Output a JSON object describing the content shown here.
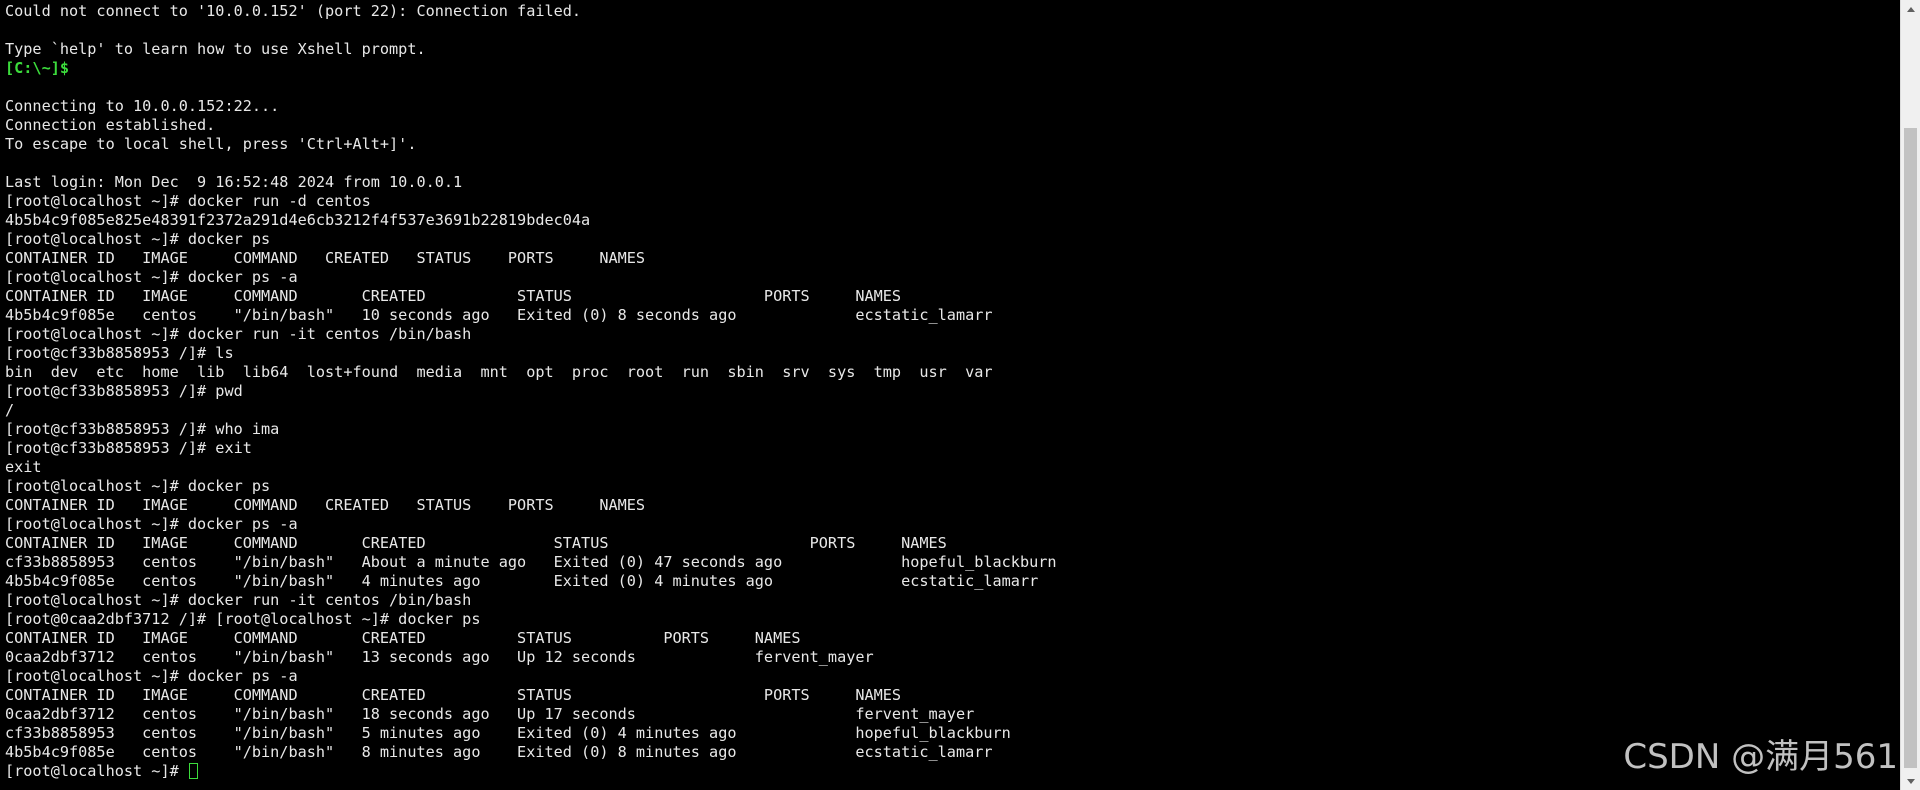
{
  "terminal": {
    "lines": [
      {
        "text": "Could not connect to '10.0.0.152' (port 22): Connection failed."
      },
      {
        "text": ""
      },
      {
        "text": "Type `help' to learn how to use Xshell prompt."
      },
      {
        "text": "[C:\\~]$"
      },
      {
        "text": ""
      },
      {
        "text": "Connecting to 10.0.0.152:22..."
      },
      {
        "text": "Connection established."
      },
      {
        "text": "To escape to local shell, press 'Ctrl+Alt+]'."
      },
      {
        "text": ""
      },
      {
        "text": "Last login: Mon Dec  9 16:52:48 2024 from 10.0.0.1"
      },
      {
        "text": "[root@localhost ~]# docker run -d centos"
      },
      {
        "text": "4b5b4c9f085e825e48391f2372a291d4e6cb3212f4f537e3691b22819bdec04a"
      },
      {
        "text": "[root@localhost ~]# docker ps"
      },
      {
        "text": "CONTAINER ID   IMAGE     COMMAND   CREATED   STATUS    PORTS     NAMES"
      },
      {
        "text": "[root@localhost ~]# docker ps -a"
      },
      {
        "text": "CONTAINER ID   IMAGE     COMMAND       CREATED          STATUS                     PORTS     NAMES"
      },
      {
        "text": "4b5b4c9f085e   centos    \"/bin/bash\"   10 seconds ago   Exited (0) 8 seconds ago             ecstatic_lamarr"
      },
      {
        "text": "[root@localhost ~]# docker run -it centos /bin/bash"
      },
      {
        "text": "[root@cf33b8858953 /]# ls"
      },
      {
        "text": "bin  dev  etc  home  lib  lib64  lost+found  media  mnt  opt  proc  root  run  sbin  srv  sys  tmp  usr  var"
      },
      {
        "text": "[root@cf33b8858953 /]# pwd"
      },
      {
        "text": "/"
      },
      {
        "text": "[root@cf33b8858953 /]# who ima"
      },
      {
        "text": "[root@cf33b8858953 /]# exit"
      },
      {
        "text": "exit"
      },
      {
        "text": "[root@localhost ~]# docker ps"
      },
      {
        "text": "CONTAINER ID   IMAGE     COMMAND   CREATED   STATUS    PORTS     NAMES"
      },
      {
        "text": "[root@localhost ~]# docker ps -a"
      },
      {
        "text": "CONTAINER ID   IMAGE     COMMAND       CREATED              STATUS                      PORTS     NAMES"
      },
      {
        "text": "cf33b8858953   centos    \"/bin/bash\"   About a minute ago   Exited (0) 47 seconds ago             hopeful_blackburn"
      },
      {
        "text": "4b5b4c9f085e   centos    \"/bin/bash\"   4 minutes ago        Exited (0) 4 minutes ago              ecstatic_lamarr"
      },
      {
        "text": "[root@localhost ~]# docker run -it centos /bin/bash"
      },
      {
        "text": "[root@0caa2dbf3712 /]# [root@localhost ~]# docker ps"
      },
      {
        "text": "CONTAINER ID   IMAGE     COMMAND       CREATED          STATUS          PORTS     NAMES"
      },
      {
        "text": "0caa2dbf3712   centos    \"/bin/bash\"   13 seconds ago   Up 12 seconds             fervent_mayer"
      },
      {
        "text": "[root@localhost ~]# docker ps -a"
      },
      {
        "text": "CONTAINER ID   IMAGE     COMMAND       CREATED          STATUS                     PORTS     NAMES"
      },
      {
        "text": "0caa2dbf3712   centos    \"/bin/bash\"   18 seconds ago   Up 17 seconds                        fervent_mayer"
      },
      {
        "text": "cf33b8858953   centos    \"/bin/bash\"   5 minutes ago    Exited (0) 4 minutes ago             hopeful_blackburn"
      },
      {
        "text": "4b5b4c9f085e   centos    \"/bin/bash\"   8 minutes ago    Exited (0) 8 minutes ago             ecstatic_lamarr"
      },
      {
        "text": "[root@localhost ~]# "
      }
    ],
    "local_prompt_line_index": 3,
    "cursor_line_index": 40,
    "text_color": "#e8e8e8",
    "prompt_color": "#3cdc3c",
    "background_color": "#000000"
  },
  "watermark": {
    "text": "CSDN @满月561"
  },
  "scrollbar": {
    "up_icon": "chevron-up-icon",
    "down_icon": "chevron-down-icon"
  }
}
